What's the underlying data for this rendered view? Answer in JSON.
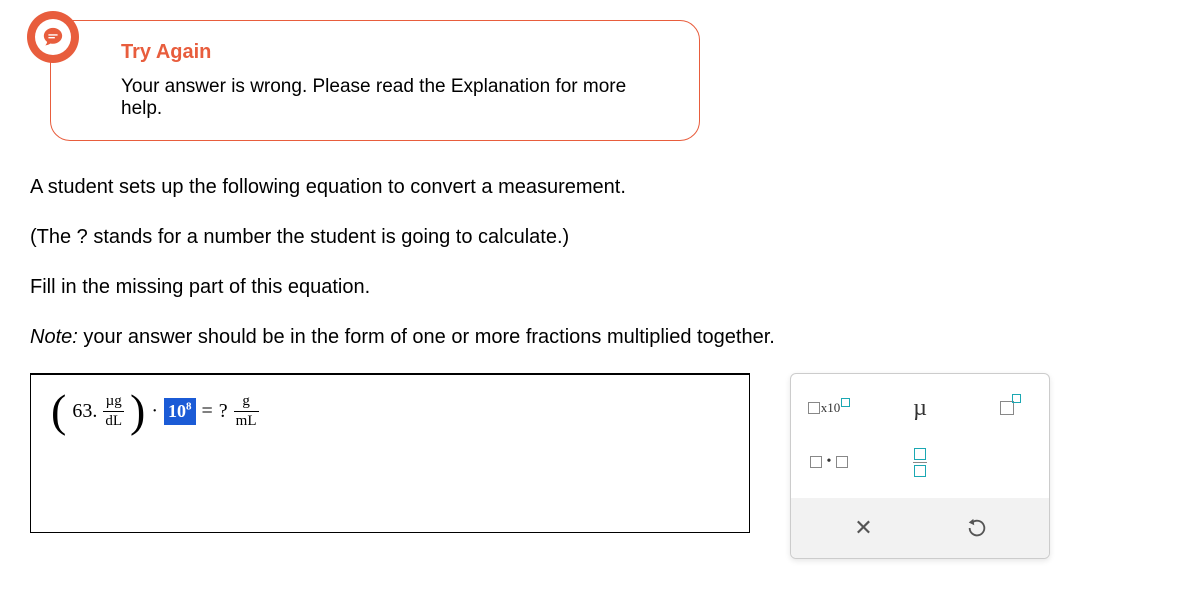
{
  "feedback": {
    "title": "Try Again",
    "message": "Your answer is wrong. Please read the Explanation for more help."
  },
  "prompt": {
    "line1": "A student sets up the following equation to convert a measurement.",
    "line2": "(The ? stands for a number the student is going to calculate.)",
    "line3": "Fill in the missing part of this equation.",
    "note_label": "Note:",
    "note_text": " your answer should be in the form of one or more fractions multiplied together."
  },
  "equation": {
    "coef": "63.",
    "unit1_num": "µg",
    "unit1_den": "dL",
    "dot": "·",
    "input_base": "10",
    "input_exp": "8",
    "equals": "=",
    "rhs": "?",
    "unit2_num": "g",
    "unit2_den": "mL"
  },
  "palette": {
    "x10_label": "x10",
    "mu_label": "µ",
    "mult_dot": "•"
  }
}
